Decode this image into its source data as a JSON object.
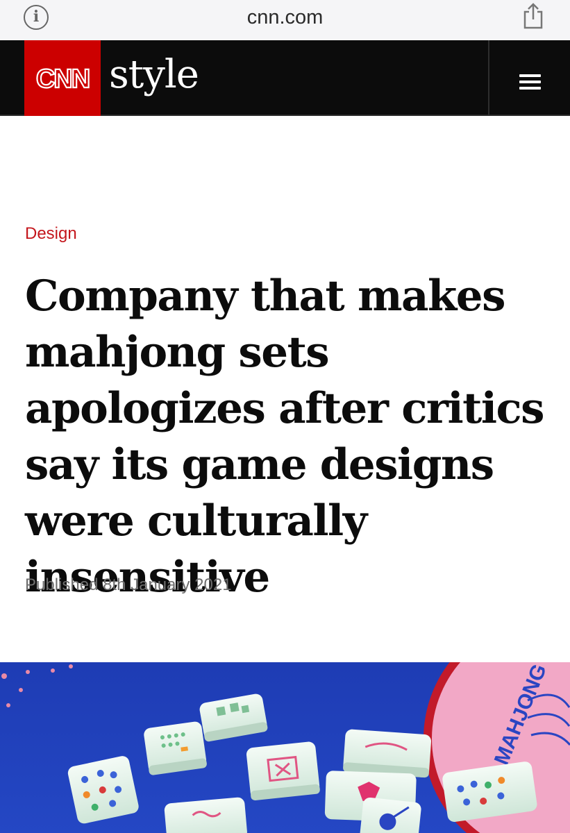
{
  "browser": {
    "url": "cnn.com",
    "info_icon": "info-icon",
    "share_icon": "share-icon"
  },
  "header": {
    "logo_text": "CNN",
    "section_brand": "style",
    "menu_icon": "hamburger-menu-icon",
    "colors": {
      "logo_red": "#cc0000",
      "bar": "#0c0c0c"
    }
  },
  "article": {
    "section": "Design",
    "headline": "Company that makes mahjong sets apologizes after critics say its game designs were culturally insensitive",
    "published": "Published 8th January 2021",
    "accent_color": "#c4161c"
  },
  "hero_image": {
    "mat_text": "MAHJONG"
  }
}
